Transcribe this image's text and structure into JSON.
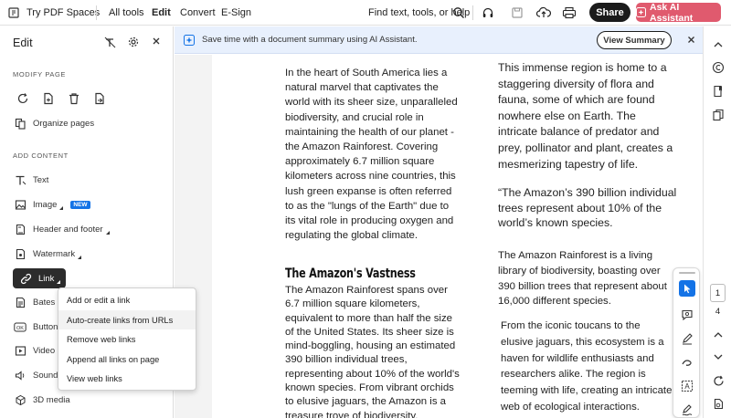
{
  "topbar": {
    "app_name": "Try PDF Spaces",
    "nav": [
      "All tools",
      "Edit",
      "Convert",
      "E-Sign"
    ],
    "search_label": "Find text, tools, or help",
    "share_label": "Share",
    "ai_label": "Ask AI Assistant"
  },
  "leftpanel": {
    "title": "Edit",
    "modify_header": "MODIFY PAGE",
    "organize_label": "Organize pages",
    "add_header": "ADD CONTENT",
    "tools": {
      "text": "Text",
      "image": "Image",
      "image_badge": "NEW",
      "header_footer": "Header and footer",
      "watermark": "Watermark",
      "link": "Link",
      "bates": "Bates n",
      "button": "Button",
      "video": "Video",
      "sound": "Sound",
      "media3d": "3D media"
    }
  },
  "banner": {
    "message": "Save time with a document summary using AI Assistant.",
    "view_summary": "View Summary"
  },
  "context_menu": {
    "items": [
      "Add or edit a link",
      "Auto-create links from URLs",
      "Remove web links",
      "Append all links on page",
      "View web links"
    ]
  },
  "document": {
    "col1_p1": [
      "In the heart of South America lies a",
      "natural marvel that captivates the",
      "world with its sheer size, unparalleled",
      "biodiversity, and crucial role in",
      "maintaining the health of our planet -",
      "the Amazon Rainforest. Covering",
      "approximately 6.7 million square",
      "kilometers across nine countries, this",
      "lush green expanse is often referred",
      "to as the \"lungs of the Earth\" due to",
      "its vital role in producing oxygen and",
      "regulating the global climate."
    ],
    "heading": "The Amazon's Vastness",
    "col1_p2": [
      "The Amazon Rainforest spans over",
      "6.7 million square kilometers,",
      "equivalent to more than half the size",
      "of the United States. Its sheer size is",
      "mind-boggling, housing an estimated",
      "390 billion individual trees,",
      "representing about 10% of the world's",
      "known species. From vibrant orchids",
      "to elusive jaguars, the Amazon is a",
      "treasure trove of biodiversity."
    ],
    "col2_p1": [
      "This immense region is home to a",
      "staggering diversity of flora and",
      "fauna, some of which are found",
      "nowhere else on Earth. The",
      "intricate balance of predator and",
      "prey, pollinator and plant, creates a",
      "mesmerizing tapestry of life."
    ],
    "col2_quote": [
      "“The Amazon’s 390 billion individual",
      "trees represent about 10% of the",
      "world’s known species."
    ],
    "col2_p2": [
      "The Amazon Rainforest is a living",
      "library of biodiversity, boasting over",
      "390 billion trees that represent about",
      "16,000 different species."
    ],
    "col2_p3": [
      "From the iconic toucans to the",
      "elusive jaguars, this ecosystem is a",
      "haven for wildlife enthusiasts and",
      "researchers alike. The region is",
      "teeming with life, creating an intricate",
      "web of ecological interactions."
    ]
  },
  "page_indicator": {
    "current": "1",
    "total": "4"
  },
  "colors": {
    "ai_button": "#e05a6e",
    "banner_bg": "#e8f0fd",
    "badge_new": "#1473e6",
    "select_tool": "#1473e6"
  }
}
